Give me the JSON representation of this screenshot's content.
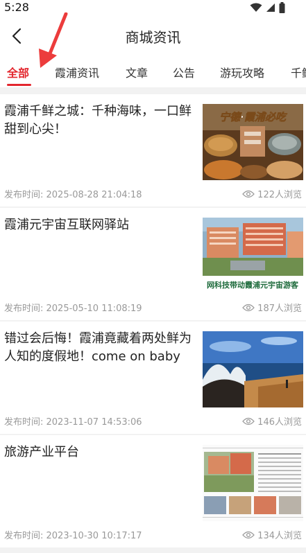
{
  "status_bar": {
    "time": "5:28"
  },
  "header": {
    "title": "商城资讯",
    "back_icon": "chevron-left-icon"
  },
  "tabs": [
    {
      "label": "全部",
      "active": true
    },
    {
      "label": "霞浦资讯"
    },
    {
      "label": "文章"
    },
    {
      "label": "公告"
    },
    {
      "label": "游玩攻略"
    },
    {
      "label": "千鲜"
    }
  ],
  "articles": [
    {
      "title": "霞浦千鲜之城：千种海味，一口鲜甜到心尖！",
      "publish": "发布时间: 2025-08-28 21:04:18",
      "views": "122人浏览",
      "thumb_caption": "宁德·霞浦必吃"
    },
    {
      "title": "霞浦元宇宙互联网驿站",
      "publish": "发布时间: 2025-05-10 11:08:19",
      "views": "187人浏览",
      "thumb_caption": "网科技带动霞浦元宇宙游客"
    },
    {
      "title": "错过会后悔！霞浦竟藏着两处鲜为人知的度假地！come on baby",
      "publish": "发布时间: 2023-11-07 14:53:06",
      "views": "146人浏览"
    },
    {
      "title": "旅游产业平台",
      "publish": "发布时间: 2023-10-30 10:17:17",
      "views": "134人浏览"
    }
  ],
  "colors": {
    "accent": "#e3262d",
    "meta": "#999999"
  }
}
